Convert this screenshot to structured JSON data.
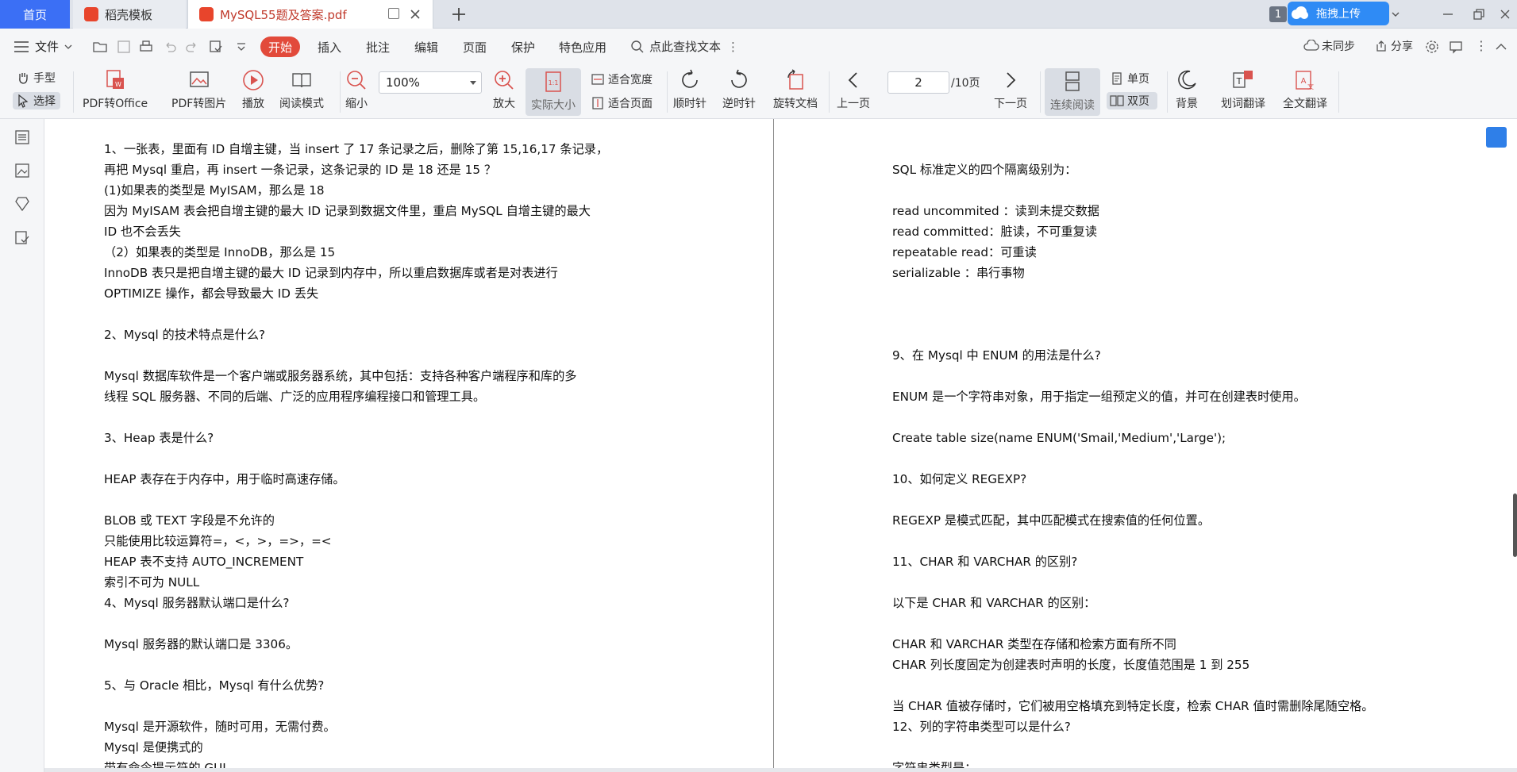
{
  "tabs": {
    "home": "首页",
    "template": "稻壳模板",
    "doc": "MySQL55题及答案.pdf"
  },
  "titlebar": {
    "badge": "1",
    "upload": "拖拽上传"
  },
  "menubar": {
    "file": "文件",
    "items": [
      "开始",
      "插入",
      "批注",
      "编辑",
      "页面",
      "保护",
      "特色应用"
    ],
    "find": "点此查找文本",
    "sync": "未同步",
    "share": "分享"
  },
  "ribbon": {
    "hand": "手型",
    "select": "选择",
    "pdf_to_office": "PDF转Office",
    "pdf_to_image": "PDF转图片",
    "play": "播放",
    "read_mode": "阅读模式",
    "zoom_out": "缩小",
    "zoom_value": "100%",
    "zoom_in": "放大",
    "actual_size": "实际大小",
    "fit_width": "适合宽度",
    "fit_page": "适合页面",
    "rotate_cw": "顺时针",
    "rotate_ccw": "逆时针",
    "rotate_doc": "旋转文档",
    "prev_page": "上一页",
    "page_current": "2",
    "page_total": "/10页",
    "next_page": "下一页",
    "continuous": "连续阅读",
    "single": "单页",
    "double": "双页",
    "background": "背景",
    "word_translate": "划词翻译",
    "full_translate": "全文翻译"
  },
  "left_page_lines": [
    "1、一张表，里面有 ID 自增主键，当 insert 了 17 条记录之后，删除了第 15,16,17 条记录，",
    "再把 Mysql 重启，再 insert 一条记录，这条记录的 ID 是 18 还是 15 ？",
    "(1)如果表的类型是 MyISAM，那么是 18",
    "因为 MyISAM 表会把自增主键的最大 ID 记录到数据文件里，重启 MySQL 自增主键的最大",
    "ID 也不会丢失",
    "（2）如果表的类型是 InnoDB，那么是 15",
    "InnoDB 表只是把自增主键的最大 ID 记录到内存中，所以重启数据库或者是对表进行",
    "OPTIMIZE 操作，都会导致最大 ID 丢失",
    "",
    "2、Mysql 的技术特点是什么?",
    "",
    "Mysql 数据库软件是一个客户端或服务器系统，其中包括：支持各种客户端程序和库的多",
    "线程 SQL 服务器、不同的后端、广泛的应用程序编程接口和管理工具。",
    "",
    "3、Heap 表是什么?",
    "",
    "HEAP 表存在于内存中，用于临时高速存储。",
    "",
    "BLOB 或 TEXT 字段是不允许的",
    "只能使用比较运算符=，<，>，=>，=<",
    "HEAP 表不支持 AUTO_INCREMENT",
    "索引不可为 NULL",
    "4、Mysql 服务器默认端口是什么?",
    "",
    "Mysql 服务器的默认端口是 3306。",
    "",
    "5、与 Oracle 相比，Mysql 有什么优势?",
    "",
    "Mysql 是开源软件，随时可用，无需付费。",
    "Mysql 是便携式的",
    "带有命令提示符的 GUI。"
  ],
  "right_page_lines": [
    "SQL 标准定义的四个隔离级别为：",
    "",
    "read uncommited ：读到未提交数据",
    "read committed：脏读，不可重复读",
    "repeatable read：可重读",
    "serializable ：串行事物",
    "",
    "",
    "",
    "9、在 Mysql 中 ENUM 的用法是什么?",
    "",
    "ENUM 是一个字符串对象，用于指定一组预定义的值，并可在创建表时使用。",
    "",
    "Create table size(name ENUM('Smail,'Medium','Large');",
    "",
    "10、如何定义 REGEXP?",
    "",
    "REGEXP 是模式匹配，其中匹配模式在搜索值的任何位置。",
    "",
    "11、CHAR 和 VARCHAR 的区别?",
    "",
    "以下是 CHAR 和 VARCHAR 的区别：",
    "",
    "CHAR 和 VARCHAR 类型在存储和检索方面有所不同",
    "CHAR 列长度固定为创建表时声明的长度，长度值范围是 1 到 255",
    "",
    "当 CHAR 值被存储时，它们被用空格填充到特定长度，检索 CHAR 值时需删除尾随空格。",
    "12、列的字符串类型可以是什么?",
    "",
    "字符串类型是："
  ],
  "colors": {
    "accent_blue": "#3b6ff5",
    "active_red": "#e24a3b",
    "pdf_red": "#c0392b"
  }
}
